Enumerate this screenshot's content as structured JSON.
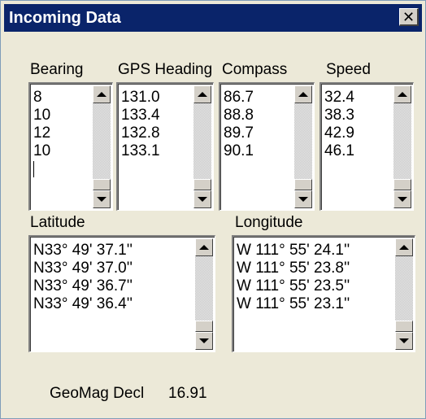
{
  "window": {
    "title": "Incoming Data",
    "close_glyph": "✕"
  },
  "labels": {
    "bearing": "Bearing",
    "gps_heading": "GPS Heading",
    "compass": "Compass",
    "speed": "Speed",
    "latitude": "Latitude",
    "longitude": "Longitude",
    "geomag_decl": "GeoMag Decl"
  },
  "lists": {
    "bearing": [
      "8",
      "10",
      "12",
      "10"
    ],
    "gps_heading": [
      "131.0",
      "133.4",
      "132.8",
      "133.1"
    ],
    "compass": [
      "86.7",
      "88.8",
      "89.7",
      "90.1"
    ],
    "speed": [
      "32.4",
      "38.3",
      "42.9",
      "46.1"
    ],
    "latitude": [
      "N33° 49' 37.1''",
      "N33° 49' 37.0''",
      "N33° 49' 36.7''",
      "N33° 49' 36.4''"
    ],
    "longitude": [
      "W 111° 55' 24.1''",
      "W 111° 55' 23.8''",
      "W 111° 55' 23.5''",
      "W 111° 55' 23.1''"
    ]
  },
  "geomag_decl_value": "16.91",
  "colors": {
    "titlebar": "#0a246a",
    "window_bg": "#ece9d8"
  }
}
